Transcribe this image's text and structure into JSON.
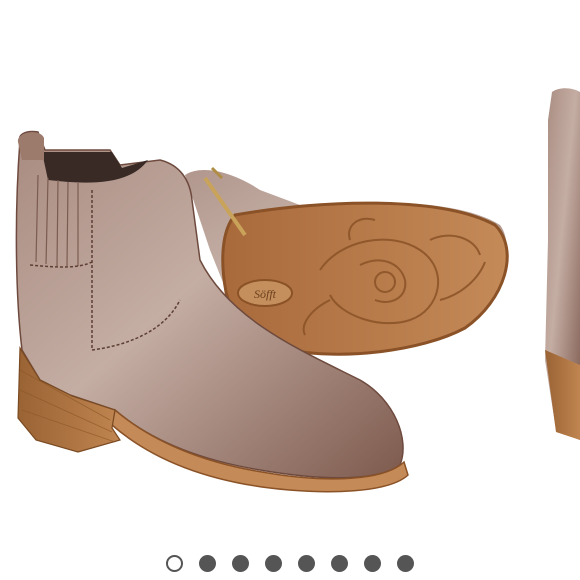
{
  "image": {
    "subject": "product-photo",
    "brand_logo_text": "Söfft"
  },
  "carousel": {
    "total_slides": 8,
    "active_index": 0,
    "colors": {
      "inactive": "#555555",
      "active_fill": "#ffffff",
      "active_border": "#555555"
    }
  },
  "colors": {
    "leather": "#8e6a5e",
    "leather_highlight": "#cdb8ae",
    "heel_wood": "#a8703e",
    "sole": "#b8794a",
    "sole_tread": "#8a5226"
  }
}
